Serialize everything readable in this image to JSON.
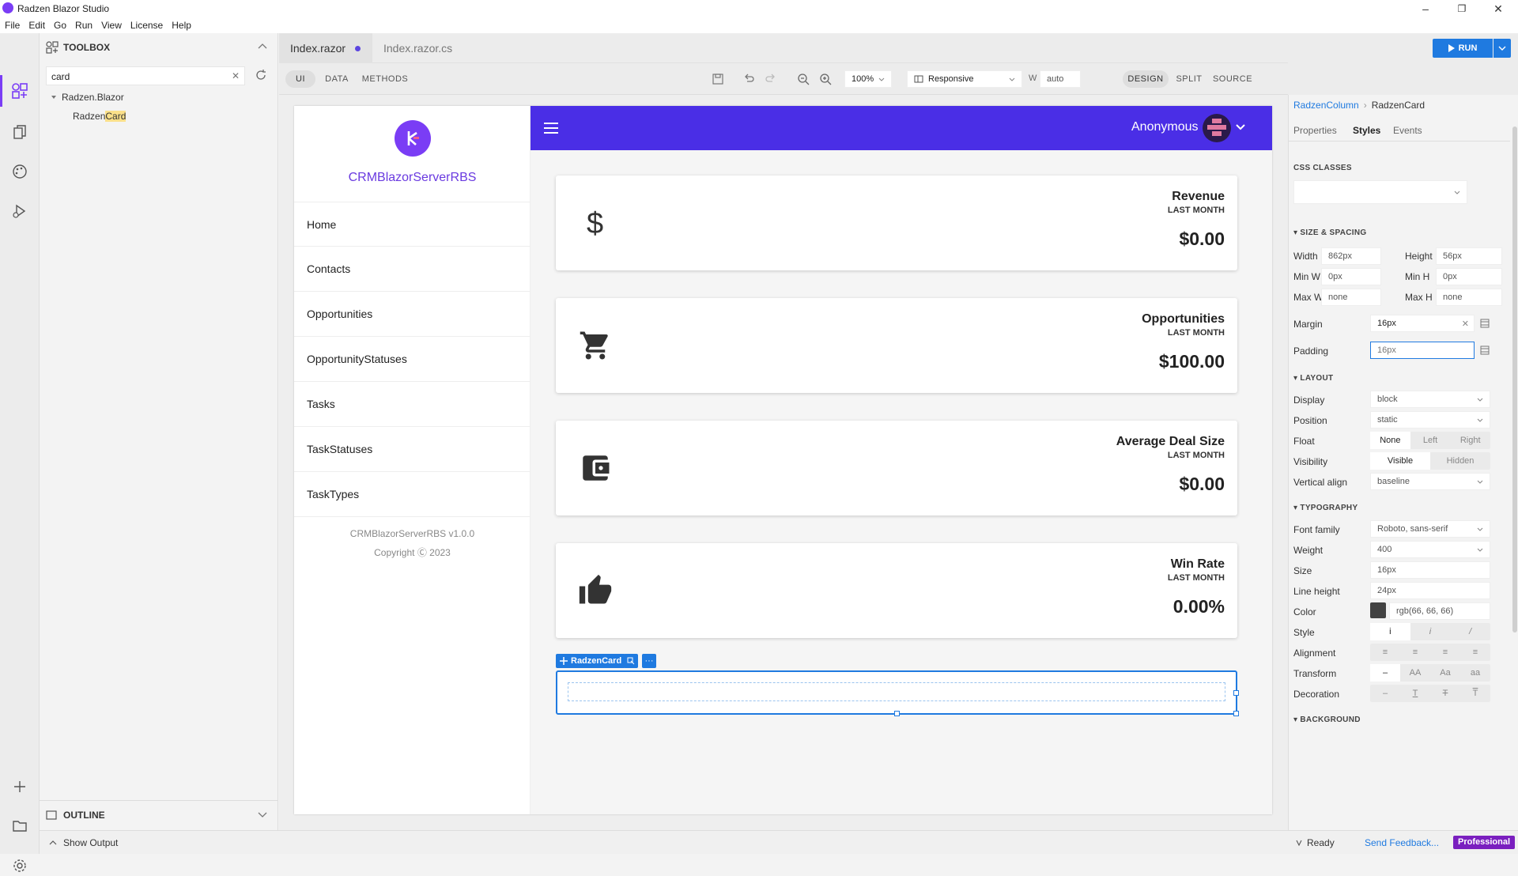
{
  "window": {
    "title": "Radzen Blazor Studio",
    "minimize": "–",
    "maximize": "❐",
    "close": "✕"
  },
  "menu": [
    "File",
    "Edit",
    "Go",
    "Run",
    "View",
    "License",
    "Help"
  ],
  "toolbox": {
    "title": "TOOLBOX",
    "search_value": "card",
    "tree_root": "Radzen.Blazor",
    "tree_item_prefix": "Radzen",
    "tree_item_match": "Card",
    "outline": "OUTLINE",
    "show_output": "Show Output"
  },
  "tabs": [
    {
      "label": "Index.razor",
      "modified": true
    },
    {
      "label": "Index.razor.cs",
      "modified": false
    }
  ],
  "toolbar": {
    "modes": [
      "UI",
      "DATA",
      "METHODS"
    ],
    "zoom": "100%",
    "device": "Responsive",
    "width_label": "W",
    "width_value": "auto",
    "run": "RUN",
    "views": [
      "DESIGN",
      "SPLIT",
      "SOURCE"
    ]
  },
  "app": {
    "name": "CRMBlazorServerRBS",
    "nav": [
      "Home",
      "Contacts",
      "Opportunities",
      "OpportunityStatuses",
      "Tasks",
      "TaskStatuses",
      "TaskTypes"
    ],
    "footer_version": "CRMBlazorServerRBS v1.0.0",
    "footer_copyright": "Copyright Ⓒ 2023",
    "user": "Anonymous",
    "cards": [
      {
        "title": "Revenue",
        "subtitle": "LAST MONTH",
        "value": "$0.00",
        "icon": "dollar-icon"
      },
      {
        "title": "Opportunities",
        "subtitle": "LAST MONTH",
        "value": "$100.00",
        "icon": "cart-icon"
      },
      {
        "title": "Average Deal Size",
        "subtitle": "LAST MONTH",
        "value": "$0.00",
        "icon": "wallet-icon"
      },
      {
        "title": "Win Rate",
        "subtitle": "LAST MONTH",
        "value": "0.00%",
        "icon": "thumbs-up-icon"
      }
    ],
    "selected_component": "RadzenCard"
  },
  "properties": {
    "breadcrumb": [
      "RadzenColumn",
      "RadzenCard"
    ],
    "tabs": [
      "Properties",
      "Styles",
      "Events"
    ],
    "active_tab": "Styles",
    "css_classes_label": "CSS CLASSES",
    "size_spacing": {
      "title": "SIZE & SPACING",
      "width_label": "Width",
      "width": "862px",
      "height_label": "Height",
      "height": "56px",
      "minw_label": "Min W",
      "minw": "0px",
      "minh_label": "Min H",
      "minh": "0px",
      "maxw_label": "Max W",
      "maxw": "none",
      "maxh_label": "Max H",
      "maxh": "none",
      "margin_label": "Margin",
      "margin": "16px",
      "padding_label": "Padding",
      "padding": "16px"
    },
    "layout": {
      "title": "LAYOUT",
      "display_label": "Display",
      "display": "block",
      "position_label": "Position",
      "position": "static",
      "float_label": "Float",
      "float_options": [
        "None",
        "Left",
        "Right"
      ],
      "visibility_label": "Visibility",
      "visibility_options": [
        "Visible",
        "Hidden"
      ],
      "valign_label": "Vertical align",
      "valign": "baseline"
    },
    "typography": {
      "title": "TYPOGRAPHY",
      "font_family_label": "Font family",
      "font_family": "Roboto, sans-serif",
      "weight_label": "Weight",
      "weight": "400",
      "size_label": "Size",
      "size": "16px",
      "line_height_label": "Line height",
      "line_height": "24px",
      "color_label": "Color",
      "color": "rgb(66, 66, 66)",
      "style_label": "Style",
      "alignment_label": "Alignment",
      "transform_label": "Transform",
      "transform_options": [
        "–",
        "AA",
        "Aa",
        "aa"
      ],
      "decoration_label": "Decoration"
    },
    "background_title": "BACKGROUND"
  },
  "status": {
    "ready": "Ready",
    "feedback": "Send Feedback...",
    "edition": "Professional"
  },
  "colors": {
    "accent": "#7a3df5",
    "header": "#4a2ee6",
    "run": "#1f7ae0",
    "selection": "#1f7ae0",
    "edition": "#7a1fbf"
  }
}
